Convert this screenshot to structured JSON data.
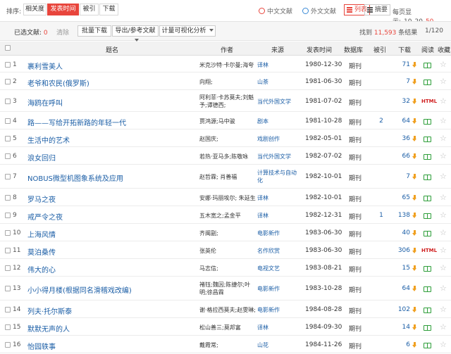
{
  "sort": {
    "label": "排序:",
    "options": [
      "相关度",
      "发表时间",
      "被引",
      "下载"
    ],
    "active_index": 1
  },
  "lang": {
    "chinese": "中文文献",
    "foreign": "外文文献"
  },
  "view": {
    "list": "列表",
    "summary": "摘要"
  },
  "per_page": {
    "label": "每页显示:",
    "options": [
      "10",
      "20",
      "50"
    ],
    "selected": "50"
  },
  "actions": {
    "selected_label": "已选文献:",
    "selected_count": "0",
    "clear": "清除",
    "batch_download": "批量下载",
    "export": "导出/参考文献",
    "visual": "计量可视化分析"
  },
  "result": {
    "prefix": "找到",
    "count": "11,593",
    "suffix": "条结果",
    "page": "1/120"
  },
  "columns": [
    "题名",
    "作者",
    "来源",
    "发表时间",
    "数据库",
    "被引",
    "下载",
    "阅读",
    "收藏"
  ],
  "colors": {
    "accent": "#e8453c",
    "link": "#1b5ea6",
    "download": "#f0a020",
    "read": "#2e9e3a"
  },
  "rows": [
    {
      "num": "1",
      "title": "裹利雪美人",
      "author": [
        "米克沙特·卡尔曼;海夸"
      ],
      "source": [
        "译林"
      ],
      "date": "1980-12-30",
      "db": "期刊",
      "cite": "",
      "dl": "71",
      "read": "book"
    },
    {
      "num": "2",
      "title": "老爷和农民(俄罗斯)",
      "author": [
        "向翔;"
      ],
      "source": [
        "山茶"
      ],
      "date": "1981-06-30",
      "db": "期刊",
      "cite": "",
      "dl": "7",
      "read": "book"
    },
    {
      "num": "3",
      "title": "海鸥在呼叫",
      "author": [
        "阿利菲·卡苏莫夫;刘魁",
        "予;谭德西;"
      ],
      "source": [
        "当代外国文学"
      ],
      "date": "1981-07-02",
      "db": "期刊",
      "cite": "",
      "dl": "32",
      "read": "html"
    },
    {
      "num": "4",
      "title": "路——写给开拓新路的年轻一代",
      "author": [
        "贾鸿源;马中骏"
      ],
      "source": [
        "剧本"
      ],
      "date": "1981-10-28",
      "db": "期刊",
      "cite": "2",
      "dl": "64",
      "read": "book"
    },
    {
      "num": "5",
      "title": "生活中的艺术",
      "author": [
        "赵国庆;"
      ],
      "source": [
        "戏剧创作"
      ],
      "date": "1982-05-01",
      "db": "期刊",
      "cite": "",
      "dl": "36",
      "read": "book"
    },
    {
      "num": "6",
      "title": "浪女回归",
      "author": [
        "若热·亚马多;陈敬咏"
      ],
      "source": [
        "当代外国文学"
      ],
      "date": "1982-07-02",
      "db": "期刊",
      "cite": "",
      "dl": "66",
      "read": "book"
    },
    {
      "num": "7",
      "title": "NOBUS微型机图象系统及应用",
      "author": [
        "赵哲霖; 肖善福"
      ],
      "source": [
        "计算技术与自动",
        "化"
      ],
      "date": "1982-10-01",
      "db": "期刊",
      "cite": "",
      "dl": "7",
      "read": "book"
    },
    {
      "num": "8",
      "title": "罗马之夜",
      "author": [
        "安娜·玛丽埃尔; 朱延生"
      ],
      "source": [
        "译林"
      ],
      "date": "1982-10-01",
      "db": "期刊",
      "cite": "",
      "dl": "65",
      "read": "book"
    },
    {
      "num": "9",
      "title": "戒严令之夜",
      "author": [
        "五木宽之;孟金平"
      ],
      "source": [
        "译林"
      ],
      "date": "1982-12-31",
      "db": "期刊",
      "cite": "1",
      "dl": "138",
      "read": "book"
    },
    {
      "num": "10",
      "title": "上海风情",
      "author": [
        "齐闽副;"
      ],
      "source": [
        "电影新作"
      ],
      "date": "1983-06-30",
      "db": "期刊",
      "cite": "",
      "dl": "40",
      "read": "book"
    },
    {
      "num": "11",
      "title": "莫泊桑传",
      "author": [
        "张英伦"
      ],
      "source": [
        "名作欣赏"
      ],
      "date": "1983-06-30",
      "db": "期刊",
      "cite": "",
      "dl": "306",
      "read": "html"
    },
    {
      "num": "12",
      "title": "伟大的心",
      "author": [
        "马志信;"
      ],
      "source": [
        "电视文艺"
      ],
      "date": "1983-08-21",
      "db": "期刊",
      "cite": "",
      "dl": "15",
      "read": "book"
    },
    {
      "num": "13",
      "title": "小小得月楼(根据同名滑稽戏改编)",
      "author": [
        "褚钰;魏因;陈捷尔;叶",
        "明;徐昌霖"
      ],
      "source": [
        "电影新作"
      ],
      "date": "1983-10-28",
      "db": "期刊",
      "cite": "",
      "dl": "64",
      "read": "book"
    },
    {
      "num": "14",
      "title": "列夫·托尔斯泰",
      "author": [
        "谢·格拉西莫夫;赵雯琳;"
      ],
      "source": [
        "电影新作"
      ],
      "date": "1984-08-28",
      "db": "期刊",
      "cite": "",
      "dl": "102",
      "read": "book"
    },
    {
      "num": "15",
      "title": "默默无声的人",
      "author": [
        "松山善三;莫邦富"
      ],
      "source": [
        "译林"
      ],
      "date": "1984-09-30",
      "db": "期刊",
      "cite": "",
      "dl": "14",
      "read": "book"
    },
    {
      "num": "16",
      "title": "怡园轶事",
      "author": [
        "戴霞常;"
      ],
      "source": [
        "山花"
      ],
      "date": "1984-11-26",
      "db": "期刊",
      "cite": "",
      "dl": "6",
      "read": "book"
    }
  ]
}
